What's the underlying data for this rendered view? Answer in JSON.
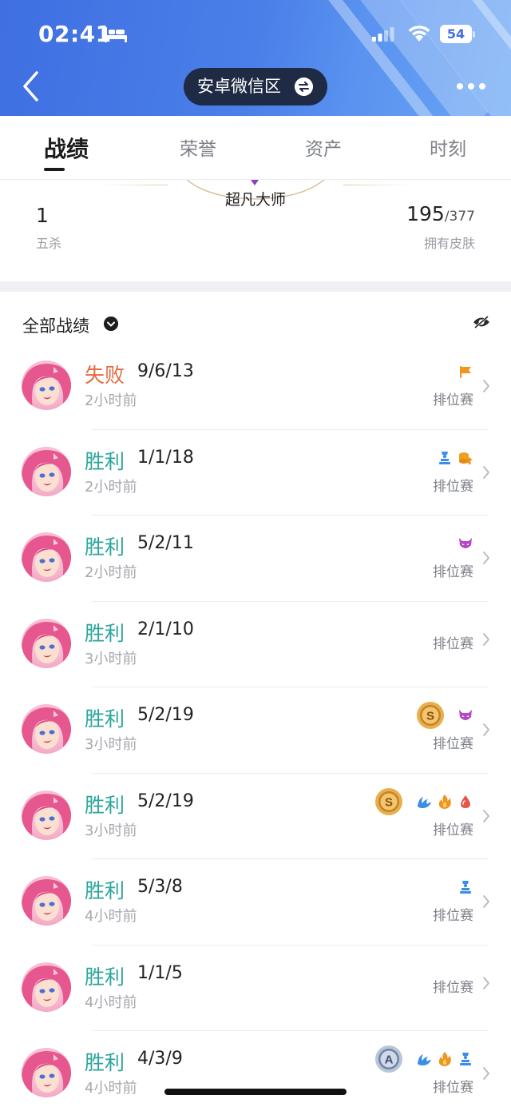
{
  "status_bar": {
    "time": "02:41",
    "battery": "54"
  },
  "nav": {
    "server": "安卓微信区"
  },
  "tabs": [
    {
      "label": "战绩",
      "active": true
    },
    {
      "label": "荣誉",
      "active": false
    },
    {
      "label": "资产",
      "active": false
    },
    {
      "label": "时刻",
      "active": false
    }
  ],
  "summary": {
    "rank": "超凡大师",
    "left_value": "1",
    "left_label": "五杀",
    "skins_owned": "195",
    "skins_total": "/377",
    "right_label": "拥有皮肤"
  },
  "records": {
    "filter_label": "全部战绩",
    "items": [
      {
        "result": "失败",
        "kda": "9/6/13",
        "ago": "2小时前",
        "mode": "排位赛",
        "badges": [
          "flag-icon"
        ]
      },
      {
        "result": "胜利",
        "kda": "1/1/18",
        "ago": "2小时前",
        "mode": "排位赛",
        "badges": [
          "tower-icon",
          "coins-up-icon"
        ]
      },
      {
        "result": "胜利",
        "kda": "5/2/11",
        "ago": "2小时前",
        "mode": "排位赛",
        "badges": [
          "demon-icon"
        ]
      },
      {
        "result": "胜利",
        "kda": "2/1/10",
        "ago": "3小时前",
        "mode": "排位赛",
        "badges": []
      },
      {
        "result": "胜利",
        "kda": "5/2/19",
        "ago": "3小时前",
        "mode": "排位赛",
        "badges": [
          "s-medal-icon",
          "demon-icon"
        ]
      },
      {
        "result": "胜利",
        "kda": "5/2/19",
        "ago": "3小时前",
        "mode": "排位赛",
        "badges": [
          "s-medal-icon",
          "wing-icon",
          "flame-icon",
          "drop-icon"
        ]
      },
      {
        "result": "胜利",
        "kda": "5/3/8",
        "ago": "4小时前",
        "mode": "排位赛",
        "badges": [
          "tower-icon"
        ]
      },
      {
        "result": "胜利",
        "kda": "1/1/5",
        "ago": "4小时前",
        "mode": "排位赛",
        "badges": []
      },
      {
        "result": "胜利",
        "kda": "4/3/9",
        "ago": "4小时前",
        "mode": "排位赛",
        "badges": [
          "a-medal-icon",
          "wing-icon",
          "flame-icon",
          "tower-icon"
        ]
      }
    ]
  },
  "colors": {
    "header": "#3f6fe2",
    "win": "#2aa69a",
    "loss": "#e26a3f",
    "pill": "#1f2a44"
  }
}
